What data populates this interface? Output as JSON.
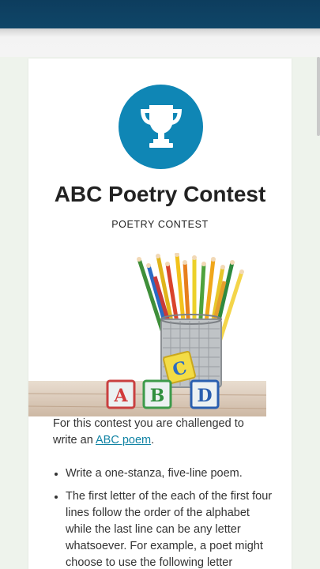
{
  "contest": {
    "title": "ABC Poetry Contest",
    "category": "POETRY CONTEST"
  },
  "icons": {
    "badge": "trophy-icon",
    "badge_color": "#0f86b5",
    "header_color": "#0f4668"
  },
  "hero": {
    "blocks": [
      "A",
      "B",
      "C",
      "D"
    ]
  },
  "intro": {
    "text_before": "For this contest you are challenged to write an ",
    "link_text": "ABC poem",
    "text_after": "."
  },
  "rules": [
    "Write a one-stanza, five-line poem.",
    "The first letter of the each of the first four lines follow the order of the alphabet while the last line can be any letter whatsoever. For example, a poet might choose to use the following letter"
  ]
}
